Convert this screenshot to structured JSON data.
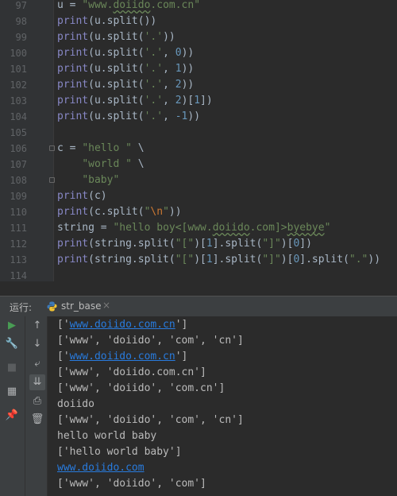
{
  "editor": {
    "lines": [
      {
        "n": "97",
        "parts": [
          [
            "u = ",
            "p"
          ],
          [
            "\"www.",
            "s"
          ],
          [
            "doiido",
            "su"
          ],
          [
            ".com.cn\"",
            "s"
          ]
        ]
      },
      {
        "n": "98",
        "parts": [
          [
            "print",
            "k"
          ],
          [
            "(u.split())",
            "p"
          ]
        ]
      },
      {
        "n": "99",
        "parts": [
          [
            "print",
            "k"
          ],
          [
            "(u.split(",
            "p"
          ],
          [
            "'.'",
            "s"
          ],
          [
            "))",
            "p"
          ]
        ]
      },
      {
        "n": "100",
        "parts": [
          [
            "print",
            "k"
          ],
          [
            "(u.split(",
            "p"
          ],
          [
            "'.'",
            "s"
          ],
          [
            ", ",
            "p"
          ],
          [
            "0",
            "n"
          ],
          [
            "))",
            "p"
          ]
        ]
      },
      {
        "n": "101",
        "parts": [
          [
            "print",
            "k"
          ],
          [
            "(u.split(",
            "p"
          ],
          [
            "'.'",
            "s"
          ],
          [
            ", ",
            "p"
          ],
          [
            "1",
            "n"
          ],
          [
            "))",
            "p"
          ]
        ]
      },
      {
        "n": "102",
        "parts": [
          [
            "print",
            "k"
          ],
          [
            "(u.split(",
            "p"
          ],
          [
            "'.'",
            "s"
          ],
          [
            ", ",
            "p"
          ],
          [
            "2",
            "n"
          ],
          [
            "))",
            "p"
          ]
        ]
      },
      {
        "n": "103",
        "parts": [
          [
            "print",
            "k"
          ],
          [
            "(u.split(",
            "p"
          ],
          [
            "'.'",
            "s"
          ],
          [
            ", ",
            "p"
          ],
          [
            "2",
            "n"
          ],
          [
            ")[",
            "p"
          ],
          [
            "1",
            "n"
          ],
          [
            "])",
            "p"
          ]
        ]
      },
      {
        "n": "104",
        "parts": [
          [
            "print",
            "k"
          ],
          [
            "(u.split(",
            "p"
          ],
          [
            "'.'",
            "s"
          ],
          [
            ", ",
            "p"
          ],
          [
            "-1",
            "n"
          ],
          [
            "))",
            "p"
          ]
        ]
      },
      {
        "n": "105",
        "parts": []
      },
      {
        "n": "106",
        "parts": [
          [
            "c = ",
            "p"
          ],
          [
            "\"hello \"",
            "s"
          ],
          [
            " \\",
            "p"
          ]
        ],
        "fold": true
      },
      {
        "n": "107",
        "parts": [
          [
            "    ",
            "p"
          ],
          [
            "\"world \"",
            "s"
          ],
          [
            " \\",
            "p"
          ]
        ]
      },
      {
        "n": "108",
        "parts": [
          [
            "    ",
            "p"
          ],
          [
            "\"baby\"",
            "s"
          ]
        ],
        "fold": true
      },
      {
        "n": "109",
        "parts": [
          [
            "print",
            "k"
          ],
          [
            "(c)",
            "p"
          ]
        ]
      },
      {
        "n": "110",
        "parts": [
          [
            "print",
            "k"
          ],
          [
            "(c.split(",
            "p"
          ],
          [
            "\"",
            "s"
          ],
          [
            "\\n",
            "e"
          ],
          [
            "\"",
            "s"
          ],
          [
            "))",
            "p"
          ]
        ]
      },
      {
        "n": "111",
        "parts": [
          [
            "string = ",
            "p"
          ],
          [
            "\"hello boy<[www.",
            "s"
          ],
          [
            "doiido",
            "su"
          ],
          [
            ".com]>",
            "s"
          ],
          [
            "byebye",
            "su"
          ],
          [
            "\"",
            "s"
          ]
        ]
      },
      {
        "n": "112",
        "parts": [
          [
            "print",
            "k"
          ],
          [
            "(string.split(",
            "p"
          ],
          [
            "\"[\"",
            "s"
          ],
          [
            ")[",
            "p"
          ],
          [
            "1",
            "n"
          ],
          [
            "].split(",
            "p"
          ],
          [
            "\"]\"",
            "s"
          ],
          [
            ")[",
            "p"
          ],
          [
            "0",
            "n"
          ],
          [
            "])",
            "p"
          ]
        ]
      },
      {
        "n": "113",
        "parts": [
          [
            "print",
            "k"
          ],
          [
            "(string.split(",
            "p"
          ],
          [
            "\"[\"",
            "s"
          ],
          [
            ")[",
            "p"
          ],
          [
            "1",
            "n"
          ],
          [
            "].split(",
            "p"
          ],
          [
            "\"]\"",
            "s"
          ],
          [
            ")[",
            "p"
          ],
          [
            "0",
            "n"
          ],
          [
            "].split(",
            "p"
          ],
          [
            "\".\"",
            "s"
          ],
          [
            "))",
            "p"
          ]
        ]
      },
      {
        "n": "114",
        "parts": []
      }
    ]
  },
  "run": {
    "title": "运行:",
    "tab_label": "str_base",
    "tab_close": "×"
  },
  "toolbar": {
    "left": [
      {
        "name": "run-icon",
        "glyph": "▶",
        "color": "#499c54",
        "interactable": true
      },
      {
        "name": "wrench-icon",
        "glyph": "🔧",
        "color": "#afb1b3",
        "interactable": true
      },
      {
        "name": "stop-icon",
        "glyph": "■",
        "color": "#5a5d5f",
        "interactable": true
      },
      {
        "name": "layout-icon",
        "glyph": "▦",
        "color": "#afb1b3",
        "interactable": true
      },
      {
        "name": "pin-icon",
        "glyph": "📌",
        "color": "#afb1b3",
        "interactable": true
      }
    ],
    "mid": [
      {
        "name": "arrow-up-icon",
        "glyph": "↑",
        "interactable": true
      },
      {
        "name": "arrow-down-icon",
        "glyph": "↓",
        "interactable": true
      },
      {
        "name": "soft-wrap-icon",
        "glyph": "⤶",
        "interactable": true
      },
      {
        "name": "scroll-to-end-icon",
        "glyph": "⇊",
        "interactable": true
      },
      {
        "name": "print-icon",
        "glyph": "⎙",
        "interactable": true
      },
      {
        "name": "trash-icon",
        "glyph": "🗑",
        "interactable": true
      }
    ]
  },
  "console": {
    "lines": [
      [
        [
          "['",
          "t"
        ],
        [
          "www.doiido.com.cn",
          "l"
        ],
        [
          "']",
          "t"
        ]
      ],
      [
        [
          "['www', 'doiido', 'com', 'cn']",
          "t"
        ]
      ],
      [
        [
          "['",
          "t"
        ],
        [
          "www.doiido.com.cn",
          "l"
        ],
        [
          "']",
          "t"
        ]
      ],
      [
        [
          "['www', 'doiido.com.cn']",
          "t"
        ]
      ],
      [
        [
          "['www', 'doiido', 'com.cn']",
          "t"
        ]
      ],
      [
        [
          "doiido",
          "t"
        ]
      ],
      [
        [
          "['www', 'doiido', 'com', 'cn']",
          "t"
        ]
      ],
      [
        [
          "hello world baby",
          "t"
        ]
      ],
      [
        [
          "['hello world baby']",
          "t"
        ]
      ],
      [
        [
          "www.doiido.com",
          "l"
        ]
      ],
      [
        [
          "['www', 'doiido', 'com']",
          "t"
        ]
      ]
    ]
  }
}
